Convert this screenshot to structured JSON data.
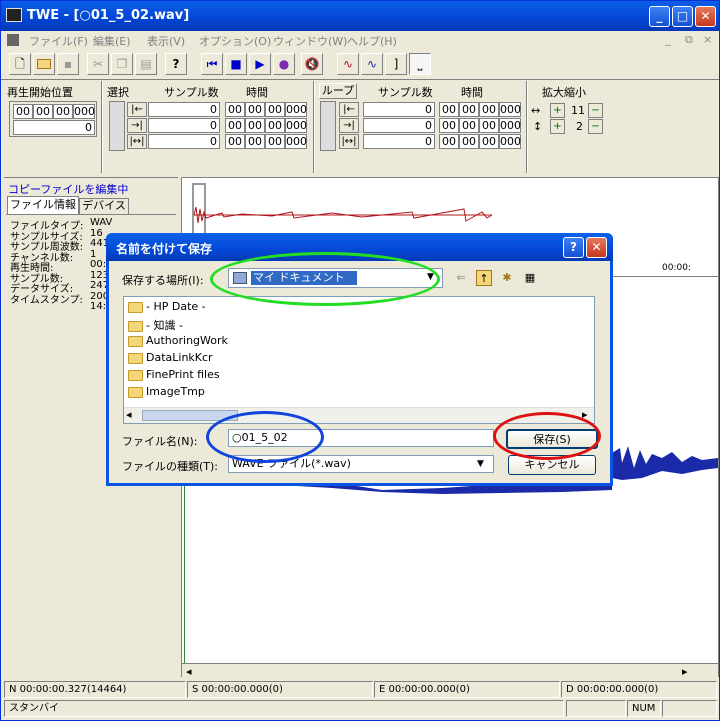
{
  "window": {
    "title": "TWE - [○01_5_02.wav]",
    "min": "_",
    "max": "□",
    "close": "✕"
  },
  "menu": [
    "ファイル(F)",
    "編集(E)",
    "表示(V)",
    "オプション(O)",
    "ウィンドウ(W)",
    "ヘルプ(H)"
  ],
  "panel": {
    "play_start_label": "再生開始位置",
    "play_start_values": [
      "00",
      "00",
      "00",
      "000"
    ],
    "play_start_samples": "0",
    "selection_label": "選択",
    "samples_label": "サンプル数",
    "time_label": "時間",
    "selection_rows": [
      {
        "samples": "0",
        "time": [
          "00",
          "00",
          "00",
          "000"
        ]
      },
      {
        "samples": "0",
        "time": [
          "00",
          "00",
          "00",
          "000"
        ]
      },
      {
        "samples": "0",
        "time": [
          "00",
          "00",
          "00",
          "000"
        ]
      }
    ],
    "loop_label": "ループ",
    "loop_rows": [
      {
        "samples": "0",
        "time": [
          "00",
          "00",
          "00",
          "000"
        ]
      },
      {
        "samples": "0",
        "time": [
          "00",
          "00",
          "00",
          "000"
        ]
      },
      {
        "samples": "0",
        "time": [
          "00",
          "00",
          "00",
          "000"
        ]
      }
    ],
    "zoom_label": "拡大縮小",
    "zoom_h": "11",
    "zoom_v": "2"
  },
  "sidebar": {
    "copy_label": "コピーファイルを編集中",
    "tabs": [
      "ファイル情報",
      "デバイス"
    ],
    "info": [
      {
        "k": "ファイルタイプ:",
        "v": "WAV"
      },
      {
        "k": "サンプルサイズ:",
        "v": "16"
      },
      {
        "k": "サンプル周波数:",
        "v": "441"
      },
      {
        "k": "チャンネル数:",
        "v": "1"
      },
      {
        "k": "再生時間:",
        "v": "00:0"
      },
      {
        "k": "サンプル数:",
        "v": "123"
      },
      {
        "k": "データサイズ:",
        "v": "247"
      },
      {
        "k": "タイムスタンプ:",
        "v": "200"
      },
      {
        "k": "",
        "v": "14:4"
      }
    ]
  },
  "ruler_text": "00:00:",
  "statusbar": {
    "n": "N 00:00:00.327(14464)",
    "s": "S 00:00:00.000(0)",
    "e": "E 00:00:00.000(0)",
    "d": "D 00:00:00.000(0)",
    "ready": "スタンバイ",
    "num": "NUM"
  },
  "dialog": {
    "title": "名前を付けて保存",
    "help": "?",
    "close": "✕",
    "save_in_label": "保存する場所(I):",
    "save_in_value": "マイ ドキュメント",
    "files": [
      "- HP Date -",
      "- 知識 -",
      "AuthoringWork",
      "DataLinkKcr",
      "FinePrint files",
      "ImageTmp"
    ],
    "filename_label": "ファイル名(N):",
    "filename_value": "○01_5_02",
    "filetype_label": "ファイルの種類(T):",
    "filetype_value": "WAVE ファイル(*.wav)",
    "save_button": "保存(S)",
    "cancel_button": "キャンセル"
  },
  "colors": {
    "title_blue": "#0445d3",
    "wave_blue": "#1a2aa8",
    "wave_red": "#b0141a",
    "ring_green": "#22dd22",
    "ring_blue": "#1144dd",
    "ring_red": "#dd1111"
  }
}
